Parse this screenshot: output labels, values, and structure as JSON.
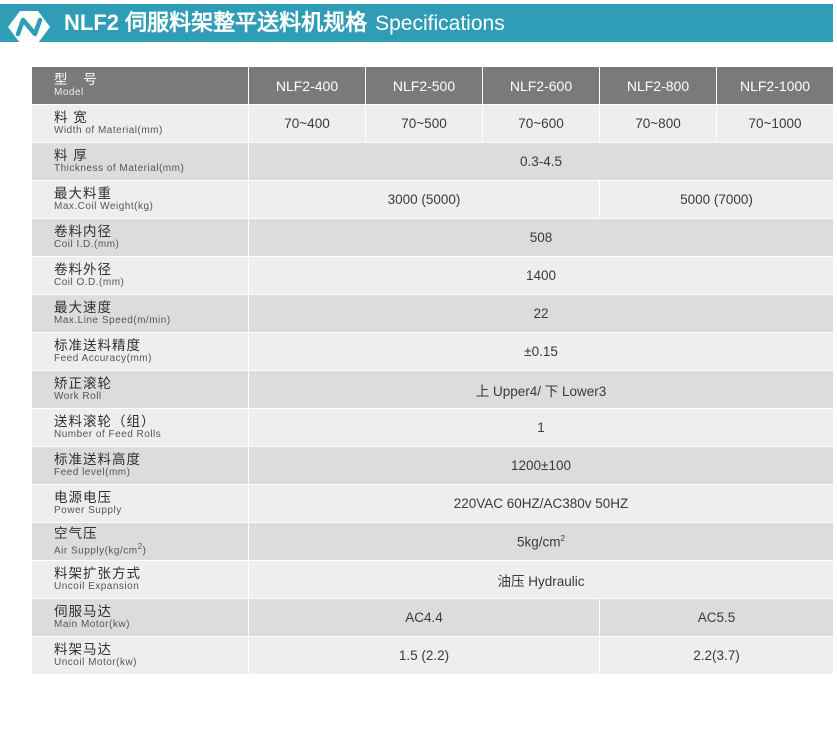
{
  "header": {
    "title_cn": "NLF2 伺服料架整平送料机规格",
    "title_en": "Specifications"
  },
  "table": {
    "model_label_cn": "型 号",
    "model_label_en": "Model",
    "models": [
      "NLF2-400",
      "NLF2-500",
      "NLF2-600",
      "NLF2-800",
      "NLF2-1000"
    ],
    "rows": {
      "width": {
        "cn": "料 宽",
        "en": "Width of Material(mm)",
        "values": [
          "70~400",
          "70~500",
          "70~600",
          "70~800",
          "70~1000"
        ]
      },
      "thickness": {
        "cn": "料 厚",
        "en": "Thickness of Material(mm)",
        "value": "0.3-4.5"
      },
      "coil_weight": {
        "cn": "最大料重",
        "en": "Max.Coil Weight(kg)",
        "value_a": "3000 (5000)",
        "value_b": "5000 (7000)"
      },
      "coil_id": {
        "cn": "卷料内径",
        "en": "Coil I.D.(mm)",
        "value": "508"
      },
      "coil_od": {
        "cn": "卷料外径",
        "en": "Coil O.D.(mm)",
        "value": "1400"
      },
      "line_speed": {
        "cn": "最大速度",
        "en": "Max.Line Speed(m/min)",
        "value": "22"
      },
      "feed_accuracy": {
        "cn": "标准送料精度",
        "en": "Feed Accuracy(mm)",
        "value": "±0.15"
      },
      "work_roll": {
        "cn": "矫正滚轮",
        "en": "Work Roll",
        "value": "上 Upper4/ 下 Lower3"
      },
      "feed_rolls": {
        "cn": "送料滚轮（组）",
        "en": "Number of Feed Rolls",
        "value": "1"
      },
      "feed_level": {
        "cn": "标准送料高度",
        "en": "Feed level(mm)",
        "value": "1200±100"
      },
      "power_supply": {
        "cn": "电源电压",
        "en": "Power Supply",
        "value": "220VAC 60HZ/AC380v 50HZ"
      },
      "air_supply": {
        "cn": "空气压",
        "en_main": "Air Supply(kg/cm",
        "en_sup": "2",
        "en_tail": ")",
        "value_main": "5kg/cm",
        "value_sup": "2"
      },
      "uncoil_expansion": {
        "cn": "料架扩张方式",
        "en": "Uncoil Expansion",
        "value": "油压 Hydraulic"
      },
      "main_motor": {
        "cn": "伺服马达",
        "en": "Main Motor(kw)",
        "value_a": "AC4.4",
        "value_b": "AC5.5"
      },
      "uncoil_motor": {
        "cn": "料架马达",
        "en": "Uncoil Motor(kw)",
        "value_a": "1.5 (2.2)",
        "value_b": "2.2(3.7)"
      }
    }
  },
  "colors": {
    "banner": "#2f9db5",
    "header_row": "#7a7a7a",
    "row_light": "#eeeeee",
    "row_dark": "#dcdcdc"
  }
}
